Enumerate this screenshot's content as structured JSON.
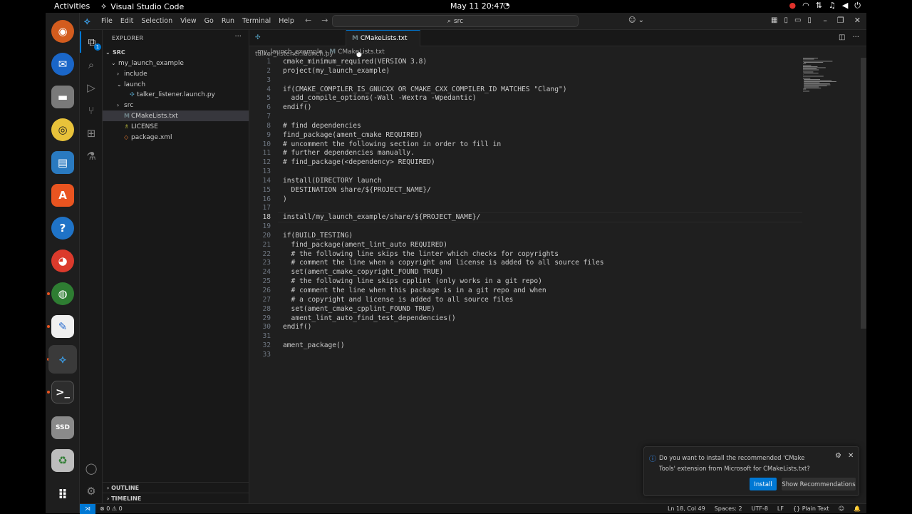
{
  "topbar": {
    "activities": "Activities",
    "app_name": "Visual Studio Code",
    "clock": "May 11  20:47"
  },
  "menu": {
    "items": [
      "File",
      "Edit",
      "Selection",
      "View",
      "Go",
      "Run",
      "Terminal",
      "Help"
    ],
    "search": "src"
  },
  "sidebar": {
    "title": "EXPLORER",
    "root": "SRC",
    "items": [
      {
        "label": "my_launch_example",
        "indent": 1,
        "twisty": "v",
        "icon": ""
      },
      {
        "label": "include",
        "indent": 2,
        "twisty": ">",
        "icon": ""
      },
      {
        "label": "launch",
        "indent": 2,
        "twisty": "v",
        "icon": ""
      },
      {
        "label": "talker_listener.launch.py",
        "indent": 3,
        "twisty": "",
        "icon": "py"
      },
      {
        "label": "src",
        "indent": 2,
        "twisty": ">",
        "icon": ""
      },
      {
        "label": "CMakeLists.txt",
        "indent": 2,
        "twisty": "",
        "icon": "M",
        "selected": true
      },
      {
        "label": "LICENSE",
        "indent": 2,
        "twisty": "",
        "icon": "lic"
      },
      {
        "label": "package.xml",
        "indent": 2,
        "twisty": "",
        "icon": "xml"
      }
    ],
    "outline": "OUTLINE",
    "timeline": "TIMELINE"
  },
  "tabs": [
    {
      "label": "talker_listener.launch.py",
      "active": false
    },
    {
      "label": "CMakeLists.txt",
      "active": true,
      "modified": true
    }
  ],
  "breadcrumb": {
    "folder": "my_launch_example",
    "file": "CMakeLists.txt"
  },
  "editor": {
    "current_line": 18,
    "lines": [
      "cmake_minimum_required(VERSION 3.8)",
      "project(my_launch_example)",
      "",
      "if(CMAKE_COMPILER_IS_GNUCXX OR CMAKE_CXX_COMPILER_ID MATCHES \"Clang\")",
      "  add_compile_options(-Wall -Wextra -Wpedantic)",
      "endif()",
      "",
      "# find dependencies",
      "find_package(ament_cmake REQUIRED)",
      "# uncomment the following section in order to fill in",
      "# further dependencies manually.",
      "# find_package(<dependency> REQUIRED)",
      "",
      "install(DIRECTORY launch",
      "  DESTINATION share/${PROJECT_NAME}/",
      ")",
      "",
      "install/my_launch_example/share/${PROJECT_NAME}/",
      "",
      "if(BUILD_TESTING)",
      "  find_package(ament_lint_auto REQUIRED)",
      "  # the following line skips the linter which checks for copyrights",
      "  # comment the line when a copyright and license is added to all source files",
      "  set(ament_cmake_copyright_FOUND TRUE)",
      "  # the following line skips cpplint (only works in a git repo)",
      "  # comment the line when this package is in a git repo and when",
      "  # a copyright and license is added to all source files",
      "  set(ament_cmake_cpplint_FOUND TRUE)",
      "  ament_lint_auto_find_test_dependencies()",
      "endif()",
      "",
      "ament_package()",
      ""
    ]
  },
  "notification": {
    "message": "Do you want to install the recommended 'CMake Tools' extension from Microsoft for CMakeLists.txt?",
    "install": "Install",
    "show": "Show Recommendations"
  },
  "status": {
    "problems": "⊗ 0 ⚠ 0",
    "position": "Ln 18, Col 49",
    "spaces": "Spaces: 2",
    "encoding": "UTF-8",
    "eol": "LF",
    "language": "Plain Text"
  },
  "colors": {
    "accent": "#0078d4",
    "ubuntu_orange": "#e95420"
  }
}
